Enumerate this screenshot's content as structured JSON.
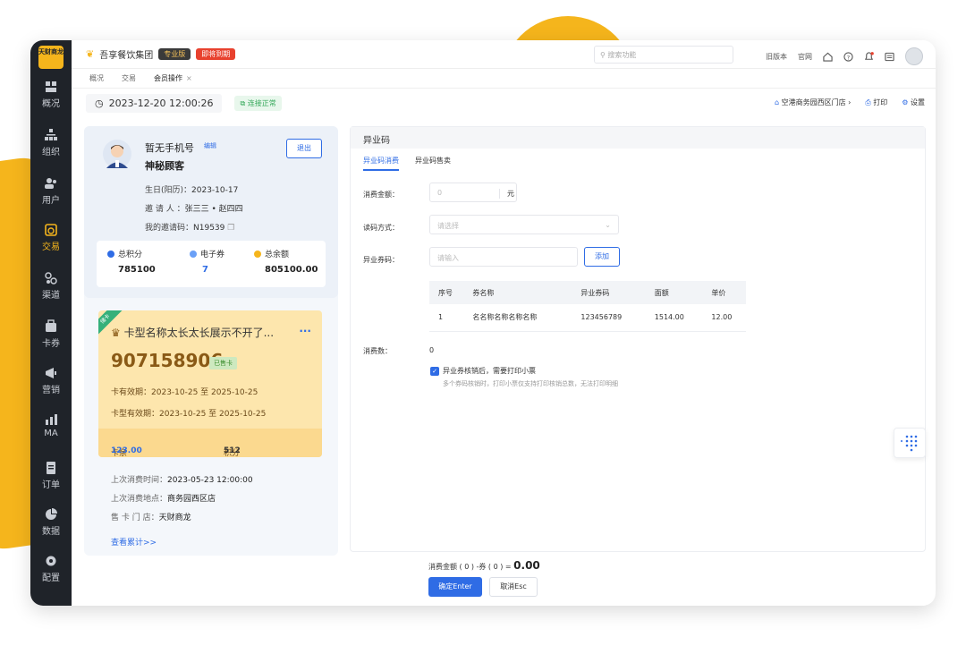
{
  "sidebar": {
    "logo_text": "天财商龙",
    "items": [
      {
        "label": "概况",
        "icon": "dashboard-icon"
      },
      {
        "label": "组织",
        "icon": "org-icon"
      },
      {
        "label": "用户",
        "icon": "users-icon"
      },
      {
        "label": "交易",
        "icon": "trade-icon",
        "active": true
      },
      {
        "label": "渠道",
        "icon": "channel-icon"
      },
      {
        "label": "卡券",
        "icon": "card-icon"
      },
      {
        "label": "营销",
        "icon": "marketing-icon"
      },
      {
        "label": "MA",
        "icon": "ma-icon"
      },
      {
        "label": "订单",
        "icon": "order-icon"
      },
      {
        "label": "数据",
        "icon": "data-icon"
      },
      {
        "label": "配置",
        "icon": "settings-icon"
      }
    ]
  },
  "topbar": {
    "company": "吾享餐饮集团",
    "badge_pro": "专业版",
    "badge_expire": "即将到期",
    "search_placeholder": "搜索功能",
    "old_version": "旧版本",
    "official_site": "官网"
  },
  "tabs": [
    {
      "label": "概况"
    },
    {
      "label": "交易"
    },
    {
      "label": "会员操作",
      "active": true,
      "closable": true
    }
  ],
  "infobar": {
    "datetime": "2023-12-20 12:00:26",
    "connection": "连接正常",
    "store": "空港商务园西区门店",
    "print": "打印",
    "settings": "设置"
  },
  "member": {
    "name": "暂无手机号",
    "edit": "编辑",
    "level": "神秘顾客",
    "exit": "退出",
    "birthday_label": "生日(阳历)：",
    "birthday": "2023-10-17",
    "inviter_label": "邀 请 人 ：",
    "inviter": "张三三 • 赵四四",
    "invite_code_label": "我的邀请码：",
    "invite_code": "N19539",
    "points_label": "总积分",
    "points": "785100",
    "coupons_label": "电子券",
    "coupons": "7",
    "balance_label": "总余额",
    "balance": "805100.00"
  },
  "card": {
    "corner": "储卡",
    "title": "卡型名称太长太长展示不开了...",
    "more": "···",
    "number": "907158906",
    "sold": "已售卡",
    "valid_label": "卡有效期：",
    "valid": "2023-10-25 至 2025-10-25",
    "type_valid_label": "卡型有效期：",
    "type_valid": "2023-10-25 至 2025-10-25",
    "balance_label": "卡余额(元)：",
    "balance": "123.00",
    "points_label": "积分(分)：",
    "points": "512"
  },
  "last": {
    "time_label": "上次消费时间：",
    "time": "2023-05-23 12:00:00",
    "place_label": "上次消费地点：",
    "place": "商务园西区店",
    "store_label": "售 卡 门 店：",
    "store": "天财商龙",
    "view_more": "查看累计>>"
  },
  "panel": {
    "title": "异业码",
    "tab1": "异业码消费",
    "tab2": "异业码售卖",
    "amount_label": "消费金额：",
    "amount_placeholder": "0",
    "amount_unit": "元",
    "read_label": "读码方式：",
    "read_placeholder": "请选择",
    "code_label": "异业券码：",
    "code_placeholder": "请输入",
    "add": "添加",
    "table_headers": [
      "序号",
      "券名称",
      "异业券码",
      "面额",
      "单价"
    ],
    "table_rows": [
      [
        "1",
        "名名称名称名称名称",
        "123456789",
        "1514.00",
        "12.00"
      ]
    ],
    "count_label": "消费数：",
    "count": "0",
    "checkbox_label": "异业券核销后，需要打印小票",
    "checkbox_hint": "多个券码核销时，打印小票仅支持打印核销总数，无法打印明细"
  },
  "footer": {
    "summary_prefix": "消费金额 ( 0 ) -券 ( 0 ) =",
    "summary_total": "0.00",
    "confirm": "确定Enter",
    "cancel": "取消Esc"
  }
}
